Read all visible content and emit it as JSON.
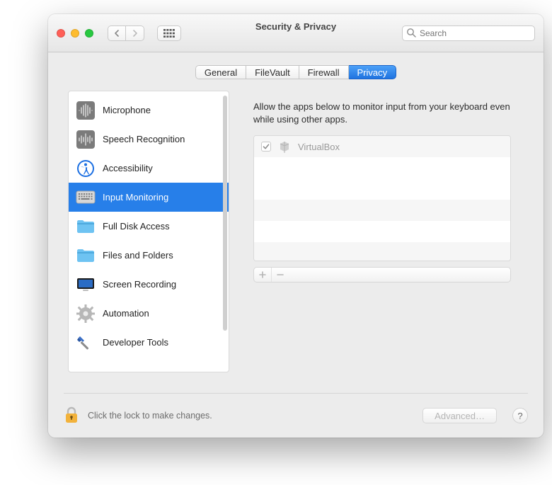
{
  "window": {
    "title": "Security & Privacy"
  },
  "search": {
    "placeholder": "Search"
  },
  "tabs": [
    {
      "id": "general",
      "label": "General",
      "active": false
    },
    {
      "id": "filevault",
      "label": "FileVault",
      "active": false
    },
    {
      "id": "firewall",
      "label": "Firewall",
      "active": false
    },
    {
      "id": "privacy",
      "label": "Privacy",
      "active": true
    }
  ],
  "sidebar": {
    "items": [
      {
        "id": "microphone",
        "label": "Microphone",
        "icon": "microphone-icon",
        "active": false
      },
      {
        "id": "speech-recognition",
        "label": "Speech Recognition",
        "icon": "waveform-icon",
        "active": false
      },
      {
        "id": "accessibility",
        "label": "Accessibility",
        "icon": "accessibility-icon",
        "active": false
      },
      {
        "id": "input-monitoring",
        "label": "Input Monitoring",
        "icon": "keyboard-icon",
        "active": true
      },
      {
        "id": "full-disk-access",
        "label": "Full Disk Access",
        "icon": "folder-fill-icon",
        "active": false
      },
      {
        "id": "files-and-folders",
        "label": "Files and Folders",
        "icon": "folder-icon",
        "active": false
      },
      {
        "id": "screen-recording",
        "label": "Screen Recording",
        "icon": "display-icon",
        "active": false
      },
      {
        "id": "automation",
        "label": "Automation",
        "icon": "gear-icon",
        "active": false
      },
      {
        "id": "developer-tools",
        "label": "Developer Tools",
        "icon": "hammer-icon",
        "active": false
      }
    ]
  },
  "main": {
    "description": "Allow the apps below to monitor input from your keyboard even while using other apps.",
    "apps": [
      {
        "name": "VirtualBox",
        "checked": true,
        "enabled": false,
        "icon": "cube-icon"
      }
    ]
  },
  "footer": {
    "lock_text": "Click the lock to make changes.",
    "advanced_label": "Advanced…",
    "help_label": "?"
  }
}
